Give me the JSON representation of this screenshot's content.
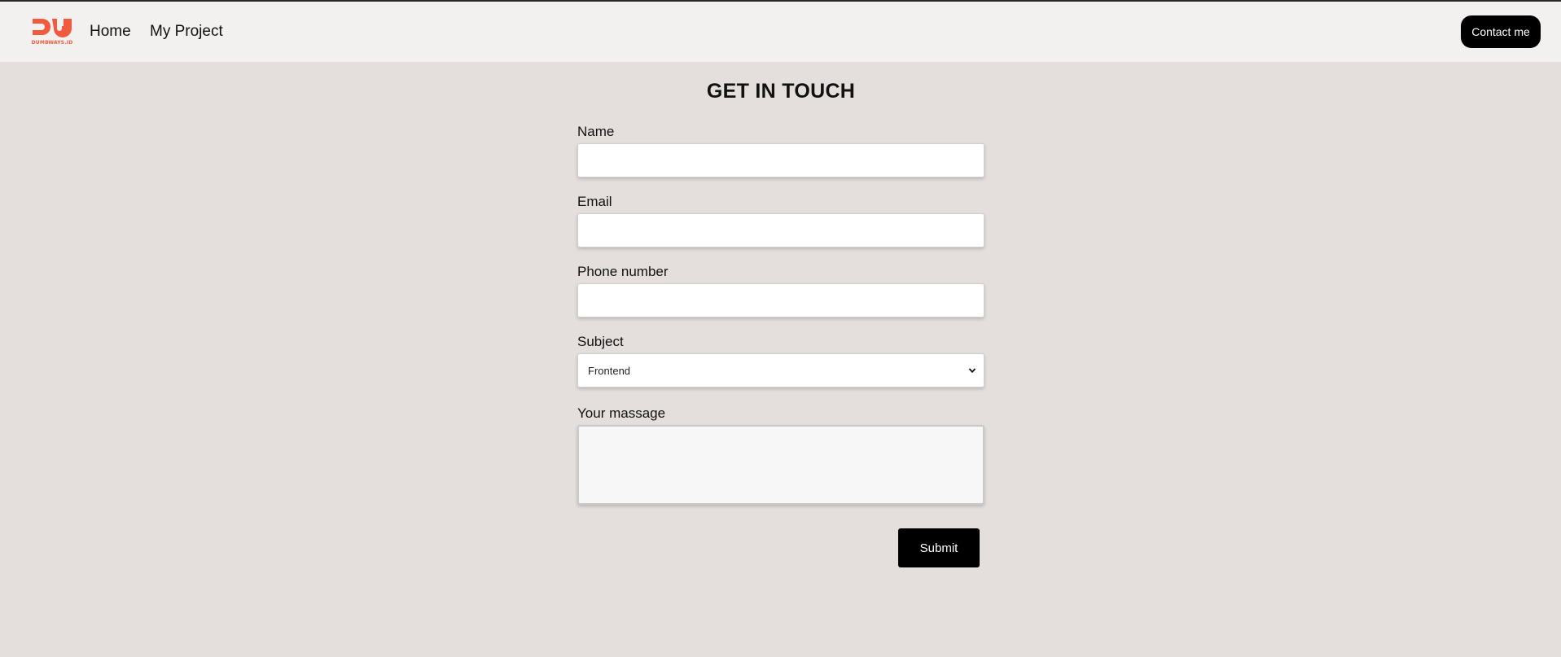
{
  "brand": {
    "logo_text": "DUMBWAYS.ID",
    "logo_color": "#f05a3e"
  },
  "nav": {
    "items": [
      {
        "label": "Home"
      },
      {
        "label": "My Project"
      }
    ],
    "contact_label": "Contact me"
  },
  "form": {
    "title": "GET IN TOUCH",
    "name": {
      "label": "Name",
      "value": "",
      "placeholder": ""
    },
    "email": {
      "label": "Email",
      "value": "",
      "placeholder": ""
    },
    "phone": {
      "label": "Phone number",
      "value": "",
      "placeholder": ""
    },
    "subject": {
      "label": "Subject",
      "selected": "Frontend"
    },
    "message": {
      "label": "Your massage",
      "value": ""
    },
    "submit_label": "Submit"
  },
  "colors": {
    "page_bg": "#e4dfdc",
    "navbar_bg": "#f3f1ef",
    "button_bg": "#000000"
  }
}
